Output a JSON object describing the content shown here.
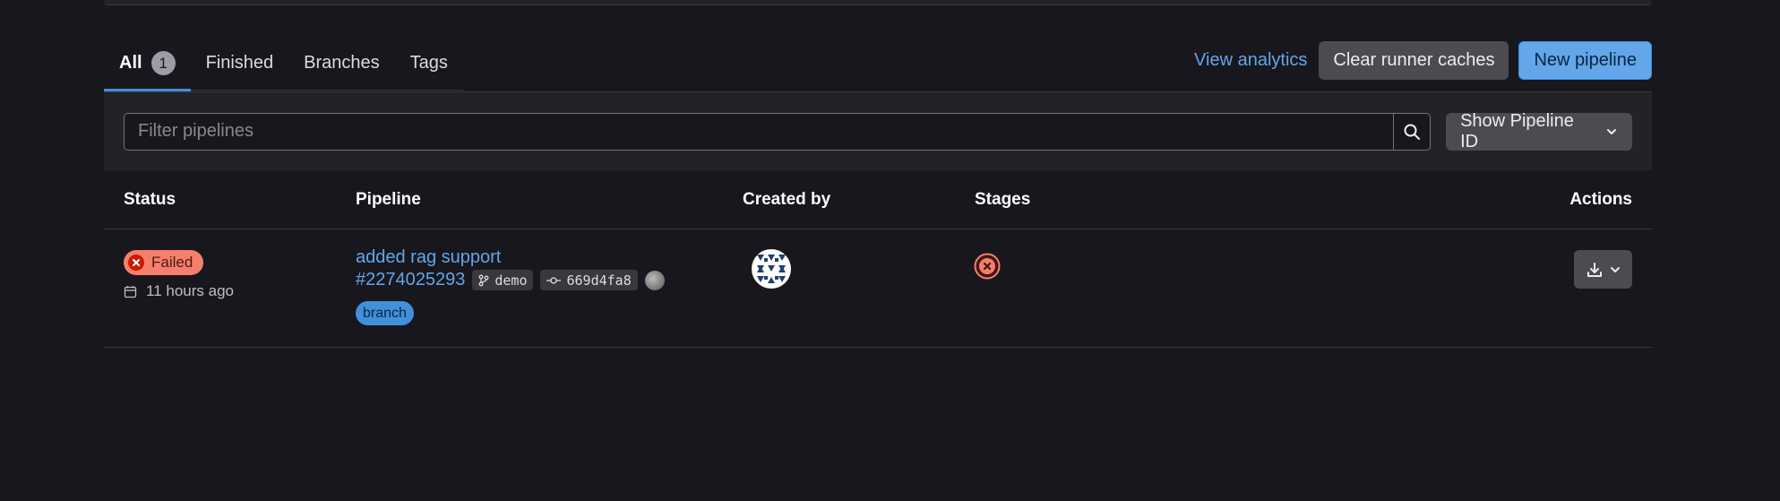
{
  "tabs": [
    {
      "label": "All",
      "count": "1",
      "active": true
    },
    {
      "label": "Finished"
    },
    {
      "label": "Branches"
    },
    {
      "label": "Tags"
    }
  ],
  "header_actions": {
    "view_analytics": "View analytics",
    "clear_caches": "Clear runner caches",
    "new_pipeline": "New pipeline"
  },
  "filter": {
    "placeholder": "Filter pipelines",
    "show_id_label": "Show Pipeline ID"
  },
  "table": {
    "columns": [
      "Status",
      "Pipeline",
      "Created by",
      "Stages",
      "Actions"
    ],
    "rows": [
      {
        "status": "Failed",
        "time_ago": "11 hours ago",
        "title": "added rag support",
        "pipeline_id": "#2274025293",
        "ref": "demo",
        "commit": "669d4fa8",
        "badge": "branch"
      }
    ]
  },
  "colors": {
    "background": "#18171d",
    "accent": "#63a6e9",
    "failed": "#f57f6c"
  }
}
